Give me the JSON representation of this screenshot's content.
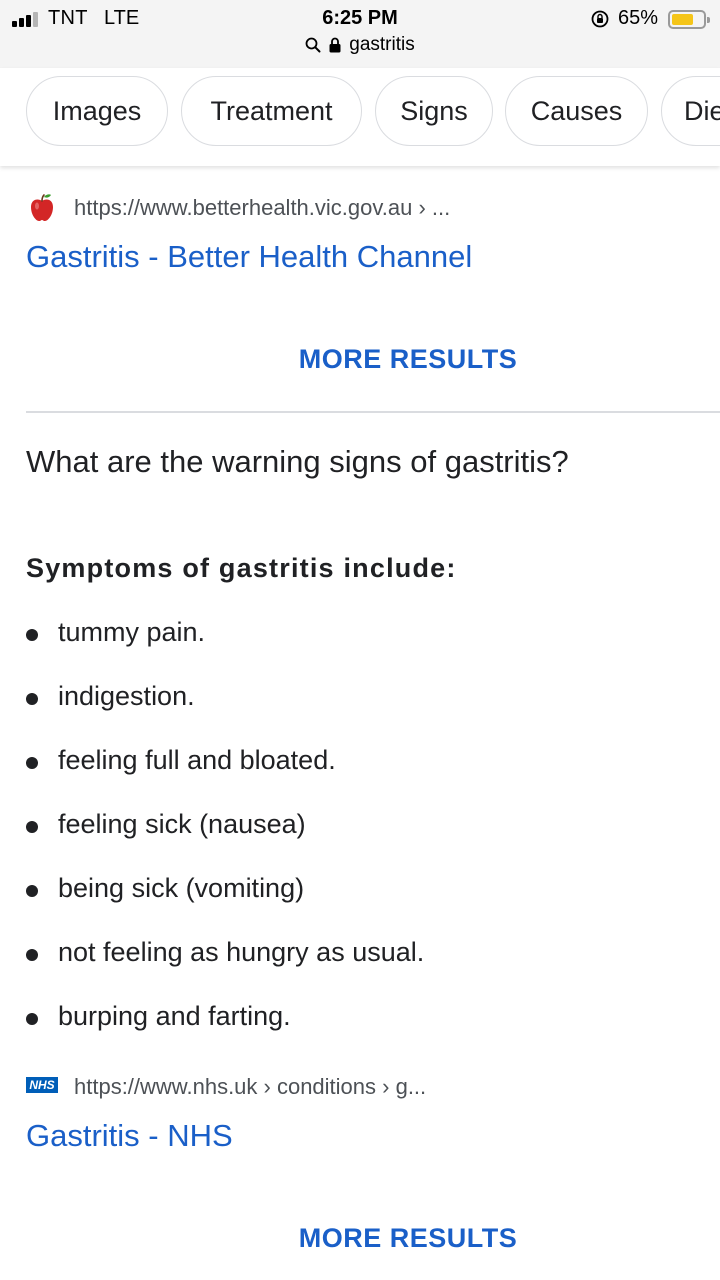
{
  "status_bar": {
    "carrier": "TNT",
    "network": "LTE",
    "time": "6:25 PM",
    "battery_percent": "65%",
    "battery_level": 0.65,
    "battery_color": "#f5c518",
    "icons": [
      "signal-icon",
      "rotation-lock-icon",
      "battery-icon"
    ]
  },
  "address_bar": {
    "query": "gastritis",
    "icons": [
      "search-icon",
      "lock-icon"
    ]
  },
  "chips": [
    "Images",
    "Treatment",
    "Signs",
    "Causes",
    "Die"
  ],
  "results": [
    {
      "favicon": "apple-icon",
      "url": "https://www.betterhealth.vic.gov.au › ...",
      "title": "Gastritis - Better Health Channel",
      "more_label": "MORE RESULTS"
    },
    {
      "favicon": "nhs-logo",
      "favicon_text": "NHS",
      "url": "https://www.nhs.uk › conditions › g...",
      "title": "Gastritis - NHS",
      "more_label": "MORE RESULTS"
    }
  ],
  "faq": {
    "question": "What are the warning signs of gastritis?",
    "heading": "Symptoms of gastritis include:",
    "items": [
      "tummy pain.",
      "indigestion.",
      "feeling full and bloated.",
      "feeling sick (nausea)",
      "being sick (vomiting)",
      "not feeling as hungry as usual.",
      "burping and farting."
    ]
  },
  "colors": {
    "link": "#1a5fc8",
    "text": "#202124",
    "url": "#4d5156",
    "chip_border": "#dadce0"
  }
}
